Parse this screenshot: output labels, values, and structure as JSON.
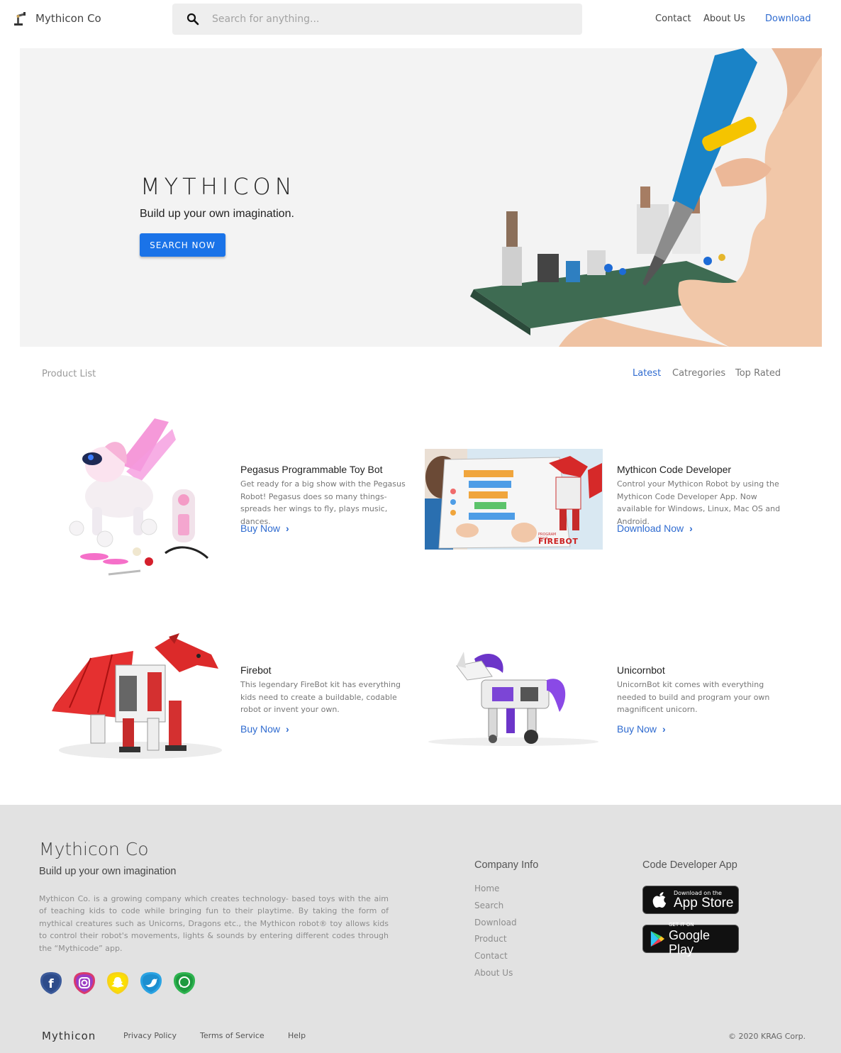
{
  "nav": {
    "brand": "Mythicon Co",
    "search_placeholder": "Search for anything...",
    "links": {
      "contact": "Contact",
      "about": "About Us",
      "download": "Download"
    }
  },
  "hero": {
    "title": "MYTHICON",
    "subtitle": "Build up your own imagination.",
    "button": "SEARCH NOW"
  },
  "product_list": {
    "label": "Product List",
    "tabs": {
      "latest": "Latest",
      "categories": "Catregories",
      "top_rated": "Top Rated"
    },
    "active_tab": "Latest",
    "products": [
      {
        "title": "Pegasus Programmable Toy Bot",
        "description": "Get ready for a big show with the Pegasus Robot! Pegasus does so many things-spreads her wings to fly, plays music, dances.",
        "link": "Buy Now"
      },
      {
        "title": "Mythicon Code Developer",
        "description": "Control your Mythicon Robot by using the Mythicon Code Developer App. Now available for Windows, Linux, Mac OS and Android.",
        "link": "Download Now",
        "image_caption_small": "PROGRAM YOUR",
        "image_caption": "FIREBOT"
      },
      {
        "title": "Firebot",
        "description": "This legendary FireBot kit has everything kids need to create a buildable, codable robot or invent your own.",
        "link": "Buy Now"
      },
      {
        "title": "Unicornbot",
        "description": "UnicornBot kit comes with everything needed to build and program your own magnificent unicorn.",
        "link": "Buy Now"
      }
    ]
  },
  "footer": {
    "brand": "Mythicon Co",
    "tagline": "Build up your own imagination",
    "about": "Mythicon Co. is a growing company which creates technology- based toys with the aim of teaching kids to code while bringing fun to their playtime. By taking the form of mythical creatures such as Unicorns, Dragons etc., the Mythicon robot® toy allows kids to control their robot's movements, lights & sounds by entering different codes through the “Mythicode” app.",
    "socials": [
      "facebook-icon",
      "instagram-icon",
      "snapchat-icon",
      "twitter-icon",
      "whatsapp-icon"
    ],
    "company_info": {
      "title": "Company Info",
      "links": [
        "Home",
        "Search",
        "Download",
        "Product",
        "Contact",
        "About Us"
      ]
    },
    "app": {
      "title": "Code Developer App",
      "appstore_small": "Download on the",
      "appstore_big": "App Store",
      "googleplay_small": "GET IT ON",
      "googleplay_big": "Google Play"
    },
    "bottom": {
      "brand": "Mythicon",
      "privacy": "Privacy Policy",
      "terms": "Terms of Service",
      "help": "Help",
      "copyright": "©  2020  KRAG Corp."
    }
  },
  "colors": {
    "accent": "#1a73e8",
    "link": "#2f6bd0",
    "footer_bg": "#e2e2e2",
    "hero_bg": "#f3f3f3"
  }
}
